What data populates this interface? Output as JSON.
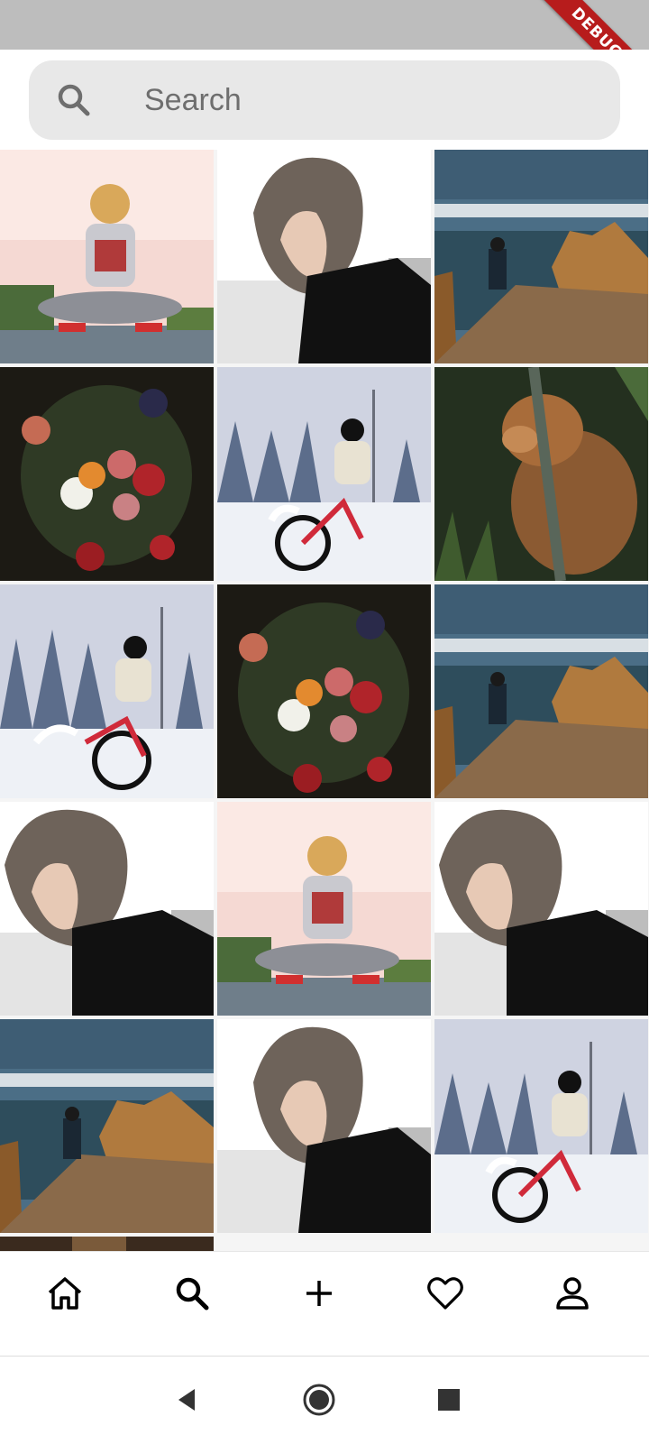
{
  "status_bar": {
    "debug_label": "DEBUG"
  },
  "search": {
    "placeholder": "Search",
    "value": ""
  },
  "grid": {
    "photos": [
      {
        "subject": "woman-sitting-harbor"
      },
      {
        "subject": "woman-short-hair-profile"
      },
      {
        "subject": "man-on-stairs-coast"
      },
      {
        "subject": "flower-bouquet-dark"
      },
      {
        "subject": "cyclist-snow"
      },
      {
        "subject": "lion-cub-grass"
      },
      {
        "subject": "cyclist-snow"
      },
      {
        "subject": "flower-bouquet-dark"
      },
      {
        "subject": "man-on-stairs-coast"
      },
      {
        "subject": "woman-short-hair-profile"
      },
      {
        "subject": "woman-sitting-harbor"
      },
      {
        "subject": "woman-short-hair-profile"
      },
      {
        "subject": "man-on-stairs-coast"
      },
      {
        "subject": "woman-short-hair-profile"
      },
      {
        "subject": "cyclist-snow"
      }
    ]
  },
  "bottom_nav": {
    "items": [
      {
        "icon": "home-icon"
      },
      {
        "icon": "search-icon"
      },
      {
        "icon": "add-icon"
      },
      {
        "icon": "heart-icon"
      },
      {
        "icon": "profile-icon"
      }
    ]
  },
  "system_nav": {
    "buttons": [
      {
        "icon": "back-icon"
      },
      {
        "icon": "home-circle-icon"
      },
      {
        "icon": "recents-icon"
      }
    ]
  },
  "colors": {
    "status_bar": "#bdbdbd",
    "debug_banner": "#b71c1c",
    "search_bg": "#e8e8e8",
    "icon": "#000000"
  }
}
